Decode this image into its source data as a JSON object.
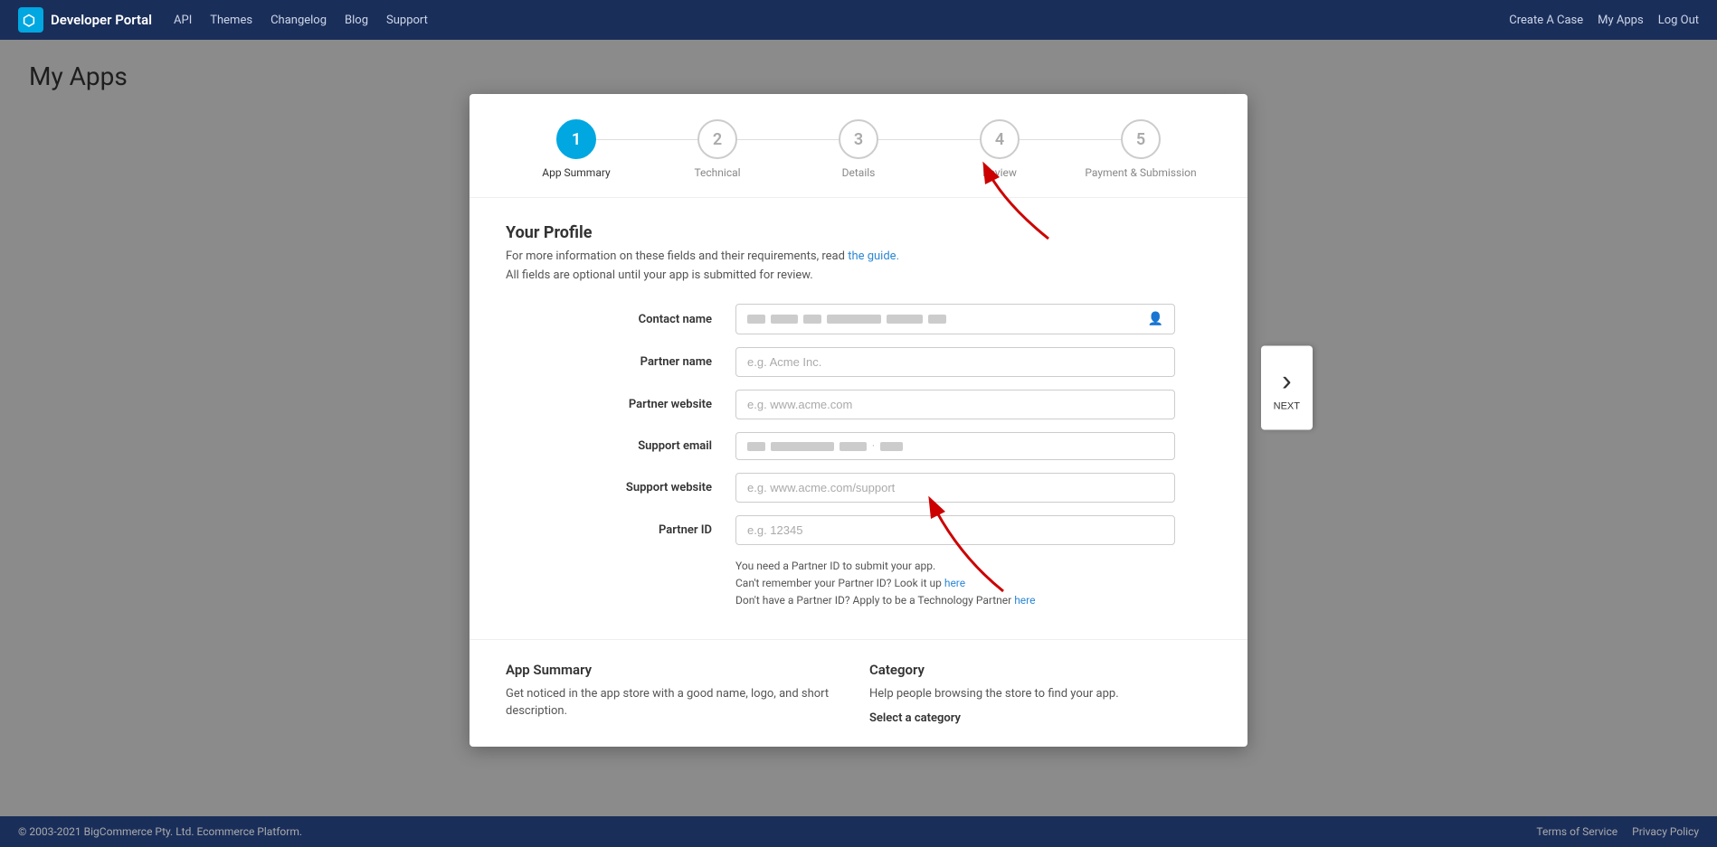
{
  "nav": {
    "brand": "Developer Portal",
    "links": [
      "API",
      "Themes",
      "Changelog",
      "Blog",
      "Support"
    ],
    "right_links": [
      "Create A Case",
      "My Apps",
      "Log Out"
    ]
  },
  "page": {
    "title": "My Apps"
  },
  "stepper": {
    "steps": [
      {
        "number": "1",
        "label": "App Summary",
        "active": true
      },
      {
        "number": "2",
        "label": "Technical",
        "active": false
      },
      {
        "number": "3",
        "label": "Details",
        "active": false
      },
      {
        "number": "4",
        "label": "Review",
        "active": false
      },
      {
        "number": "5",
        "label": "Payment & Submission",
        "active": false
      }
    ]
  },
  "form": {
    "section_title": "Your Profile",
    "desc": "For more information on these fields and their requirements, read",
    "desc_link": "the guide.",
    "optional_note": "All fields are optional until your app is submitted for review.",
    "fields": [
      {
        "label": "Contact name",
        "type": "redacted",
        "placeholder": ""
      },
      {
        "label": "Partner name",
        "type": "text",
        "placeholder": "e.g. Acme Inc."
      },
      {
        "label": "Partner website",
        "type": "text",
        "placeholder": "e.g. www.acme.com"
      },
      {
        "label": "Support email",
        "type": "redacted",
        "placeholder": ""
      },
      {
        "label": "Support website",
        "type": "text",
        "placeholder": "e.g. www.acme.com/support"
      },
      {
        "label": "Partner ID",
        "type": "text",
        "placeholder": "e.g. 12345"
      }
    ],
    "partner_id_help": [
      "You need a Partner ID to submit your app.",
      "Can't remember your Partner ID? Look it up",
      "here",
      "Don't have a Partner ID? Apply to be a Technology Partner",
      "here"
    ]
  },
  "bottom": {
    "left": {
      "title": "App Summary",
      "text": "Get noticed in the app store with a good name, logo, and short description."
    },
    "right": {
      "title": "Category",
      "text": "Help people browsing the store to find your app.",
      "sub": "Select a category"
    }
  },
  "next": {
    "label": "NEXT",
    "chevron": "›"
  },
  "footer": {
    "copyright": "© 2003-2021 BigCommerce Pty. Ltd. Ecommerce Platform.",
    "links": [
      "Terms of Service",
      "Privacy Policy"
    ]
  }
}
